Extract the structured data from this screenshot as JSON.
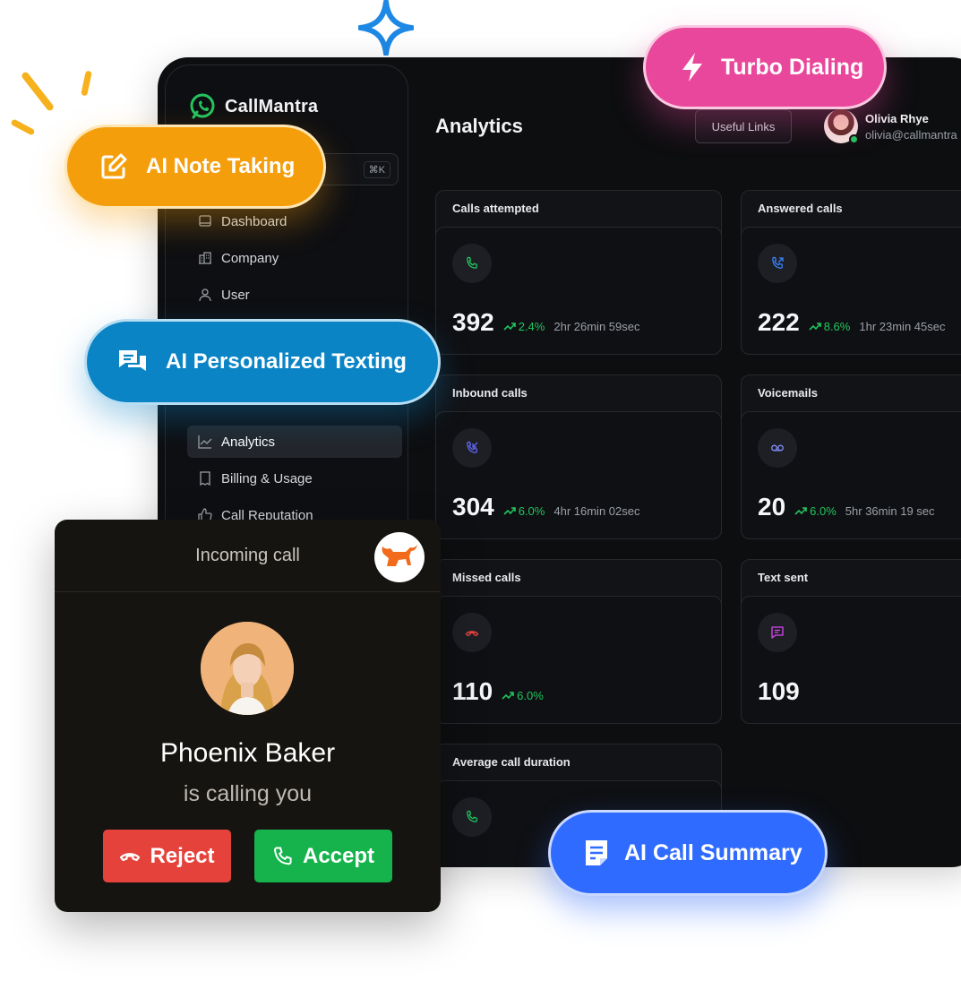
{
  "app": {
    "brand_name": "CallMantra",
    "search_shortcut": "⌘K",
    "page_title": "Analytics",
    "useful_links_label": "Useful Links",
    "user": {
      "name": "Olivia Rhye",
      "email": "olivia@callmantra"
    }
  },
  "sidebar": {
    "items": [
      {
        "label": "Dashboard",
        "icon": "monitor-icon"
      },
      {
        "label": "Company",
        "icon": "building-icon"
      },
      {
        "label": "User",
        "icon": "user-icon"
      },
      {
        "label": "Analytics",
        "icon": "chart-line-icon",
        "active": true
      },
      {
        "label": "Billing & Usage",
        "icon": "receipt-icon"
      },
      {
        "label": "Call Reputation",
        "icon": "thumbs-up-icon"
      }
    ]
  },
  "cards": [
    {
      "title": "Calls attempted",
      "value": "392",
      "trend": "2.4%",
      "time": "2hr 26min 59sec",
      "icon": "phone-icon",
      "icon_color": "#22c55e"
    },
    {
      "title": "Answered calls",
      "value": "222",
      "trend": "8.6%",
      "time": "1hr 23min 45sec",
      "icon": "phone-outgoing-icon",
      "icon_color": "#3b82f6"
    },
    {
      "title": "Inbound calls",
      "value": "304",
      "trend": "6.0%",
      "time": "4hr 16min 02sec",
      "icon": "phone-incoming-icon",
      "icon_color": "#6366f1"
    },
    {
      "title": "Voicemails",
      "value": "20",
      "trend": "6.0%",
      "time": "5hr 36min 19 sec",
      "icon": "voicemail-icon",
      "icon_color": "#818cf8"
    },
    {
      "title": "Missed calls",
      "value": "110",
      "trend": "6.0%",
      "time": "",
      "icon": "phone-hangup-icon",
      "icon_color": "#ef4444"
    },
    {
      "title": "Text sent",
      "value": "109",
      "trend": "",
      "time": "",
      "icon": "message-icon",
      "icon_color": "#d946ef"
    },
    {
      "title": "Average call duration",
      "value": "",
      "trend": "",
      "time": "",
      "icon": "phone-icon",
      "icon_color": "#22c55e"
    }
  ],
  "features": {
    "note_taking": "AI Note Taking",
    "turbo_dialing": "Turbo Dialing",
    "personalized_texting": "AI Personalized Texting",
    "call_summary": "AI Call Summary"
  },
  "incoming_call": {
    "header": "Incoming call",
    "caller_name": "Phoenix Baker",
    "subtitle": "is calling you",
    "reject_label": "Reject",
    "accept_label": "Accept"
  },
  "colors": {
    "note_taking": "#f59e0b",
    "turbo_dialing": "#e9479b",
    "personalized_texting": "#0b84c6",
    "call_summary": "#2f6bff",
    "reject": "#e5423c",
    "accept": "#16b34d",
    "trend_up": "#22c55e"
  }
}
